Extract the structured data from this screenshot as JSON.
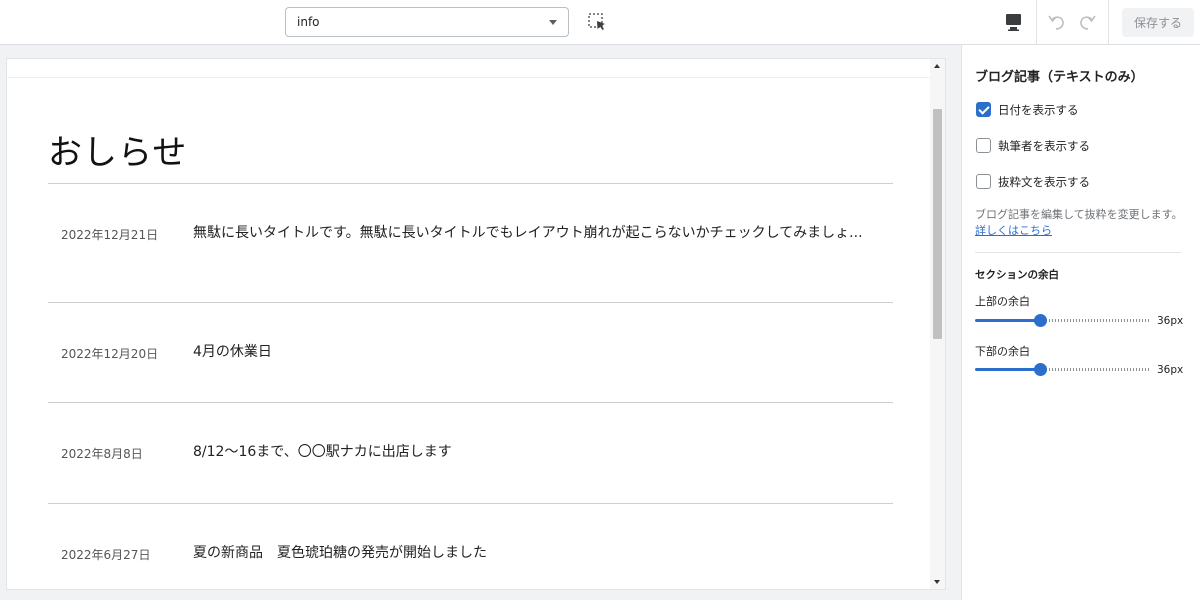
{
  "toolbar": {
    "page_select": "info",
    "save_label": "保存する"
  },
  "preview": {
    "heading": "おしらせ",
    "posts": [
      {
        "date": "2022年12月21日",
        "title": "無駄に長いタイトルです。無駄に長いタイトルでもレイアウト崩れが起こらないかチェックしてみましょ..."
      },
      {
        "date": "2022年12月20日",
        "title": "4月の休業日"
      },
      {
        "date": "2022年8月8日",
        "title": "8/12～16まで、〇〇駅ナカに出店します"
      },
      {
        "date": "2022年6月27日",
        "title": "夏の新商品　夏色琥珀糖の発売が開始しました"
      }
    ]
  },
  "panel": {
    "title": "ブログ記事（テキストのみ）",
    "checkboxes": [
      {
        "label": "日付を表示する",
        "checked": true
      },
      {
        "label": "執筆者を表示する",
        "checked": false
      },
      {
        "label": "抜粋文を表示する",
        "checked": false
      }
    ],
    "help_text": "ブログ記事を編集して抜粋を変更します。",
    "help_link": "詳しくはこちら",
    "section_title": "セクションの余白",
    "top_padding": {
      "label": "上部の余白",
      "value": "36px",
      "fraction": 0.37
    },
    "bottom_padding": {
      "label": "下部の余白",
      "value": "36px",
      "fraction": 0.37
    }
  },
  "colors": {
    "accent": "#2c6ecb"
  }
}
